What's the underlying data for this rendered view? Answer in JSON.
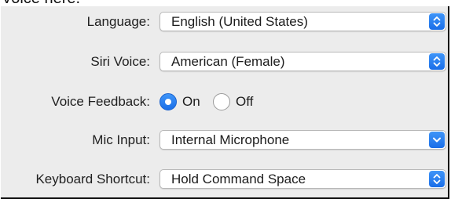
{
  "header": {
    "partial_text": "Voice here."
  },
  "settings": {
    "language": {
      "label": "Language:",
      "value": "English (United States)",
      "control": "popup-stepper"
    },
    "siri_voice": {
      "label": "Siri Voice:",
      "value": "American (Female)",
      "control": "popup-stepper"
    },
    "voice_feedback": {
      "label": "Voice Feedback:",
      "options": [
        {
          "label": "On",
          "selected": true
        },
        {
          "label": "Off",
          "selected": false
        }
      ]
    },
    "mic_input": {
      "label": "Mic Input:",
      "value": "Internal Microphone",
      "control": "popup-chevron"
    },
    "keyboard_shortcut": {
      "label": "Keyboard Shortcut:",
      "value": "Hold Command Space",
      "control": "popup-stepper"
    }
  },
  "colors": {
    "accent": "#2b80f3",
    "panel_background": "#ececec",
    "popup_background": "#ffffff"
  },
  "icons": {
    "stepper": "up-down-chevrons-icon",
    "dropdown": "chevron-down-icon"
  }
}
